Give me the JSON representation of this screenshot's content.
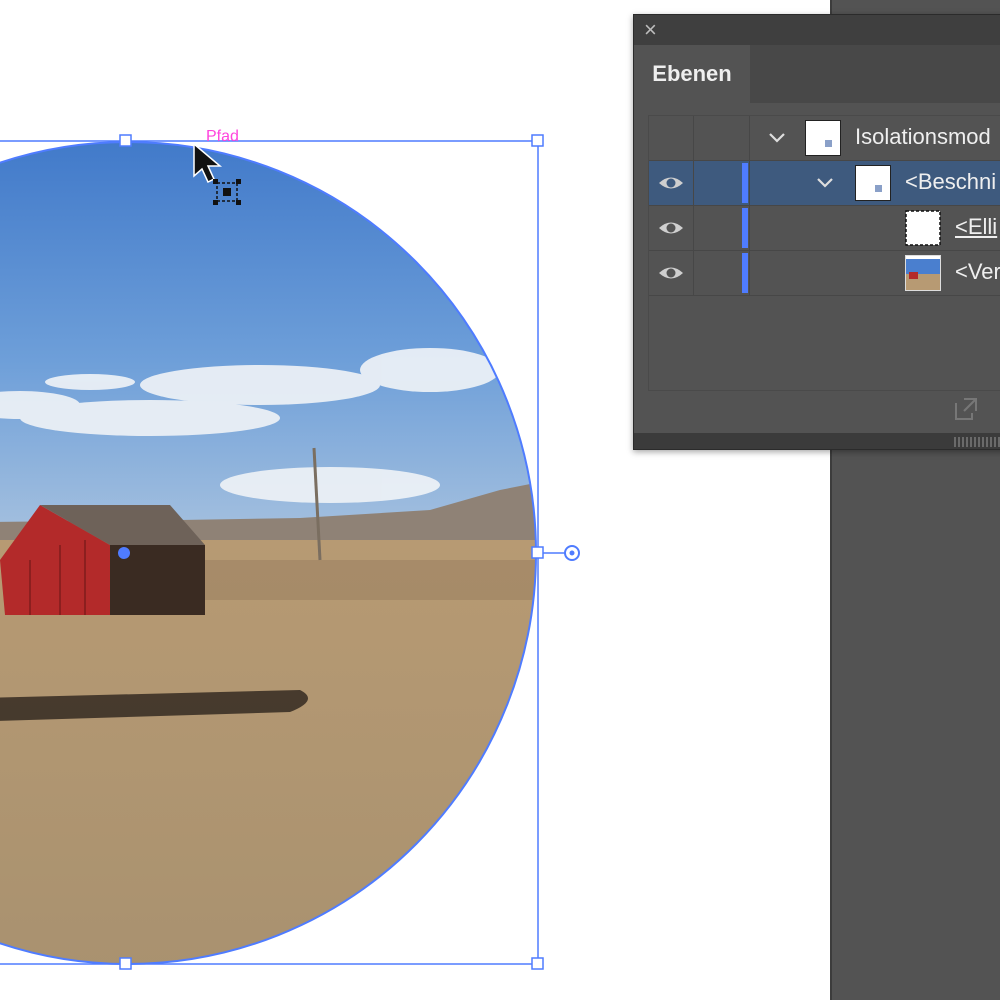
{
  "canvas": {
    "path_hint_label": "Pfad",
    "icons": [
      "arrow-cursor-icon",
      "clip-target-icon"
    ],
    "selection_color": "#4f7cff",
    "hint_color": "#ff44dd"
  },
  "layers_panel": {
    "tab_label": "Ebenen",
    "selected_row_color": "#3e5a7e",
    "layer_color": "#4f7cff",
    "rows": [
      {
        "name": "Isolationsmod",
        "visible": false,
        "expanded": true,
        "selected": false
      },
      {
        "name": "<Beschni",
        "visible": true,
        "expanded": true,
        "selected": true
      },
      {
        "name": "<Elli",
        "visible": true,
        "expanded": false,
        "selected": false
      },
      {
        "name": "<Ver",
        "visible": true,
        "expanded": false,
        "selected": false
      }
    ]
  }
}
